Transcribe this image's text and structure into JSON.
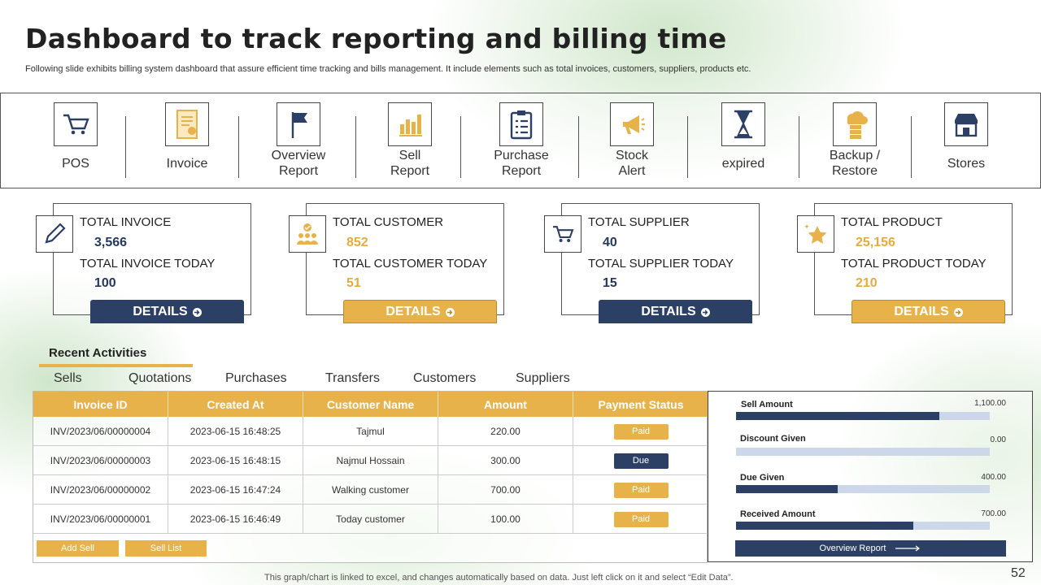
{
  "title": "Dashboard to track reporting and billing time",
  "subtitle": "Following slide exhibits billing system dashboard that assure efficient time tracking and bills management. It include elements such as total invoices, customers, suppliers, products etc.",
  "nav": [
    {
      "label": "POS",
      "icon": "cart-icon"
    },
    {
      "label": "Invoice",
      "icon": "invoice-icon"
    },
    {
      "label": "Overview\nReport",
      "icon": "flag-icon"
    },
    {
      "label": "Sell\nReport",
      "icon": "bar-chart-icon"
    },
    {
      "label": "Purchase\nReport",
      "icon": "clipboard-icon"
    },
    {
      "label": "Stock\nAlert",
      "icon": "megaphone-icon"
    },
    {
      "label": "expired",
      "icon": "hourglass-icon"
    },
    {
      "label": "Backup /\nRestore",
      "icon": "cloud-server-icon"
    },
    {
      "label": "Stores",
      "icon": "store-icon"
    }
  ],
  "cards": [
    {
      "label": "TOTAL INVOICE",
      "value": "3,566",
      "label_today": "TOTAL INVOICE  TODAY",
      "value_today": "100",
      "button": "DETAILS",
      "icon": "pencil-icon"
    },
    {
      "label": "TOTAL CUSTOMER",
      "value": "852",
      "label_today": "TOTAL CUSTOMER TODAY",
      "value_today": "51",
      "button": "DETAILS",
      "icon": "customers-icon"
    },
    {
      "label": "TOTAL SUPPLIER",
      "value": "40",
      "label_today": "TOTAL SUPPLIER TODAY",
      "value_today": "15",
      "button": "DETAILS",
      "icon": "cart-icon"
    },
    {
      "label": "TOTAL PRODUCT",
      "value": "25,156",
      "label_today": "TOTAL PRODUCT TODAY",
      "value_today": "210",
      "button": "DETAILS",
      "icon": "star-icon"
    }
  ],
  "recent": {
    "title": "Recent Activities",
    "tabs": [
      "Sells",
      "Quotations",
      "Purchases",
      "Transfers",
      "Customers",
      "Suppliers"
    ],
    "columns": [
      "Invoice ID",
      "Created At",
      "Customer Name",
      "Amount",
      "Payment Status"
    ],
    "rows": [
      {
        "id": "INV/2023/06/00000004",
        "created": "2023-06-15 16:48:25",
        "customer": "Tajmul",
        "amount": "220.00",
        "status": "Paid"
      },
      {
        "id": "INV/2023/06/00000003",
        "created": "2023-06-15 16:48:15",
        "customer": "Najmul Hossain",
        "amount": "300.00",
        "status": "Due"
      },
      {
        "id": "INV/2023/06/00000002",
        "created": "2023-06-15 16:47:24",
        "customer": "Walking customer",
        "amount": "700.00",
        "status": "Paid"
      },
      {
        "id": "INV/2023/06/00000001",
        "created": "2023-06-15 16:46:49",
        "customer": "Today customer",
        "amount": "100.00",
        "status": "Paid"
      }
    ],
    "add_sell": "Add Sell",
    "sell_list": "Sell List"
  },
  "summary": {
    "items": [
      {
        "label": "Sell Amount",
        "value": "1,100.00",
        "fraction": 0.8
      },
      {
        "label": "Discount Given",
        "value": "0.00",
        "fraction": 0.0
      },
      {
        "label": "Due Given",
        "value": "400.00",
        "fraction": 0.4
      },
      {
        "label": "Received Amount",
        "value": "700.00",
        "fraction": 0.7
      }
    ],
    "button": "Overview Report"
  },
  "colors": {
    "navy": "#2c4066",
    "gold": "#e8b24a"
  },
  "footer": "This graph/chart is linked to excel,  and changes automatically based on data. Just left click on it and select “Edit Data”.",
  "page_number": "52"
}
